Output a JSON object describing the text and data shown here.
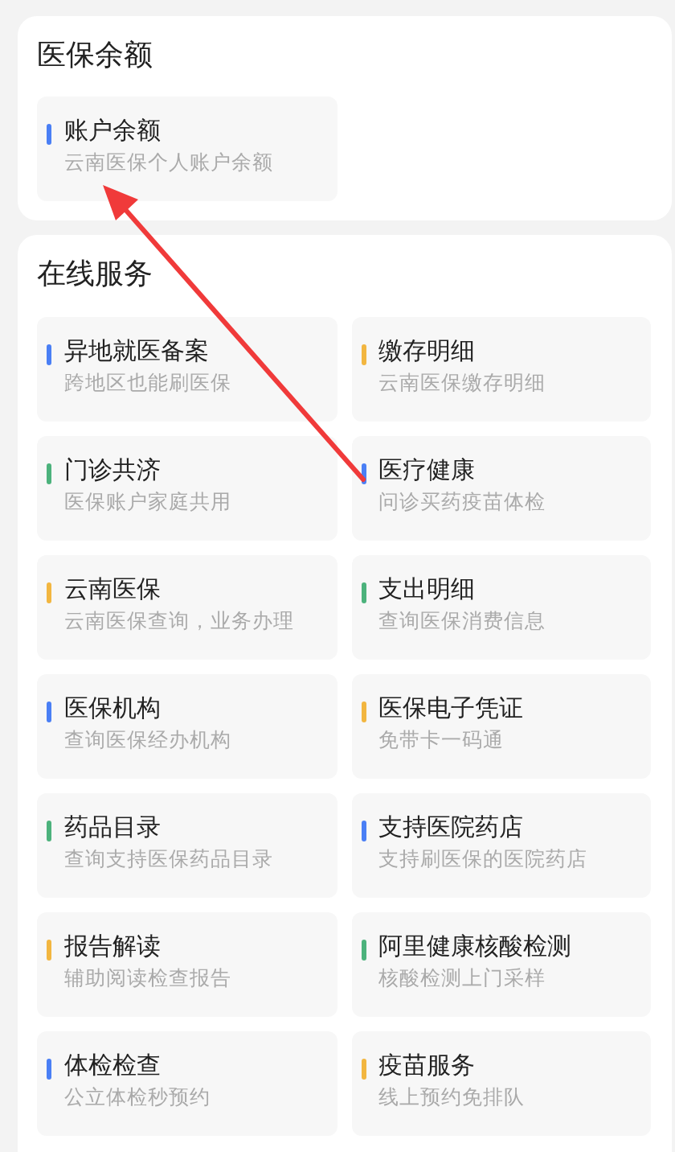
{
  "balance_section": {
    "title": "医保余额",
    "items": [
      {
        "title": "账户余额",
        "subtitle": "云南医保个人账户余额",
        "color": "#4a7ff5"
      }
    ]
  },
  "services_section": {
    "title": "在线服务",
    "items": [
      {
        "title": "异地就医备案",
        "subtitle": "跨地区也能刷医保",
        "color": "#4a7ff5"
      },
      {
        "title": "缴存明细",
        "subtitle": "云南医保缴存明细",
        "color": "#f2b640"
      },
      {
        "title": "门诊共济",
        "subtitle": "医保账户家庭共用",
        "color": "#4cb27c"
      },
      {
        "title": "医疗健康",
        "subtitle": "问诊买药疫苗体检",
        "color": "#4a7ff5"
      },
      {
        "title": "云南医保",
        "subtitle": "云南医保查询，业务办理",
        "color": "#f2b640"
      },
      {
        "title": "支出明细",
        "subtitle": "查询医保消费信息",
        "color": "#4cb27c"
      },
      {
        "title": "医保机构",
        "subtitle": "查询医保经办机构",
        "color": "#4a7ff5"
      },
      {
        "title": "医保电子凭证",
        "subtitle": "免带卡一码通",
        "color": "#f2b640"
      },
      {
        "title": "药品目录",
        "subtitle": "查询支持医保药品目录",
        "color": "#4cb27c"
      },
      {
        "title": "支持医院药店",
        "subtitle": "支持刷医保的医院药店",
        "color": "#4a7ff5"
      },
      {
        "title": "报告解读",
        "subtitle": "辅助阅读检查报告",
        "color": "#f2b640"
      },
      {
        "title": "阿里健康核酸检测",
        "subtitle": "核酸检测上门采样",
        "color": "#4cb27c"
      },
      {
        "title": "体检检查",
        "subtitle": "公立体检秒预约",
        "color": "#4a7ff5"
      },
      {
        "title": "疫苗服务",
        "subtitle": "线上预约免排队",
        "color": "#f2b640"
      }
    ]
  }
}
